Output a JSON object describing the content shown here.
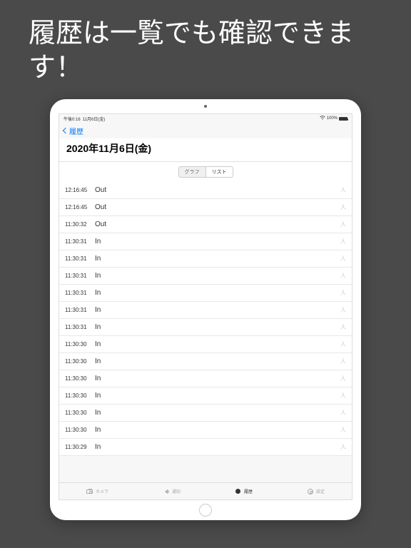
{
  "promo": {
    "text": "履歴は一覧でも確認できます！"
  },
  "statusBar": {
    "time": "午後0:16",
    "date": "11月6日(金)",
    "batteryPercent": "100%"
  },
  "nav": {
    "backLabel": "履歴"
  },
  "header": {
    "dateTitle": "2020年11月6日(金)"
  },
  "segments": {
    "graph": "グラフ",
    "list": "リスト"
  },
  "rows": [
    {
      "time": "12:16:45",
      "status": "Out",
      "tag": "人"
    },
    {
      "time": "12:16:45",
      "status": "Out",
      "tag": "人"
    },
    {
      "time": "11:30:32",
      "status": "Out",
      "tag": "人"
    },
    {
      "time": "11:30:31",
      "status": "In",
      "tag": "人"
    },
    {
      "time": "11:30:31",
      "status": "In",
      "tag": "人"
    },
    {
      "time": "11:30:31",
      "status": "In",
      "tag": "人"
    },
    {
      "time": "11:30:31",
      "status": "In",
      "tag": "人"
    },
    {
      "time": "11:30:31",
      "status": "In",
      "tag": "人"
    },
    {
      "time": "11:30:31",
      "status": "In",
      "tag": "人"
    },
    {
      "time": "11:30:30",
      "status": "In",
      "tag": "人"
    },
    {
      "time": "11:30:30",
      "status": "In",
      "tag": "人"
    },
    {
      "time": "11:30:30",
      "status": "In",
      "tag": "人"
    },
    {
      "time": "11:30:30",
      "status": "In",
      "tag": "人"
    },
    {
      "time": "11:30:30",
      "status": "In",
      "tag": "人"
    },
    {
      "time": "11:30:30",
      "status": "In",
      "tag": "人"
    },
    {
      "time": "11:30:29",
      "status": "In",
      "tag": "人"
    }
  ],
  "tabs": {
    "camera": "カメラ",
    "notify": "通知",
    "history": "履歴",
    "settings": "設定"
  }
}
